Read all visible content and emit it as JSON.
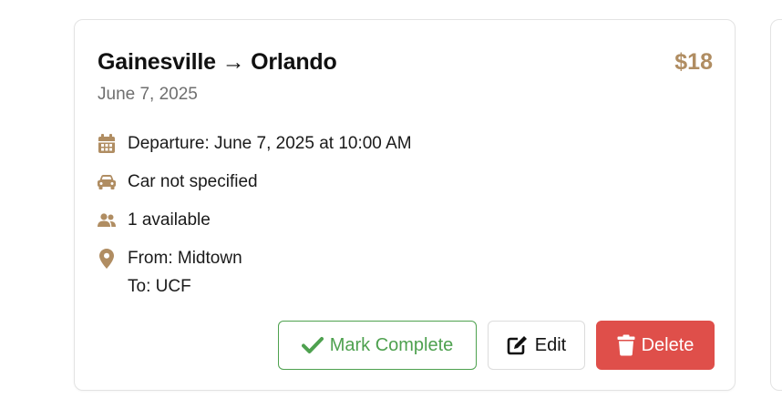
{
  "ride": {
    "title": "Gainesville → Orlando",
    "price": "$18",
    "date": "June 7, 2025",
    "departure": "Departure: June 7, 2025 at 10:00 AM",
    "car": "Car not specified",
    "seats": "1 available",
    "from": "From: Midtown",
    "to": "To: UCF"
  },
  "actions": {
    "mark_complete_label": "Mark Complete",
    "edit_label": "Edit",
    "delete_label": "Delete"
  },
  "icons": {
    "departure": "calendar-icon",
    "car": "car-icon",
    "seats": "users-icon",
    "location": "map-pin-icon",
    "mark_complete": "check-icon",
    "edit": "edit-icon",
    "delete": "trash-icon"
  },
  "colors": {
    "accent": "#b08d62",
    "success": "#4ea14f",
    "danger": "#df4f4a",
    "muted_text": "#6f6f6f"
  }
}
